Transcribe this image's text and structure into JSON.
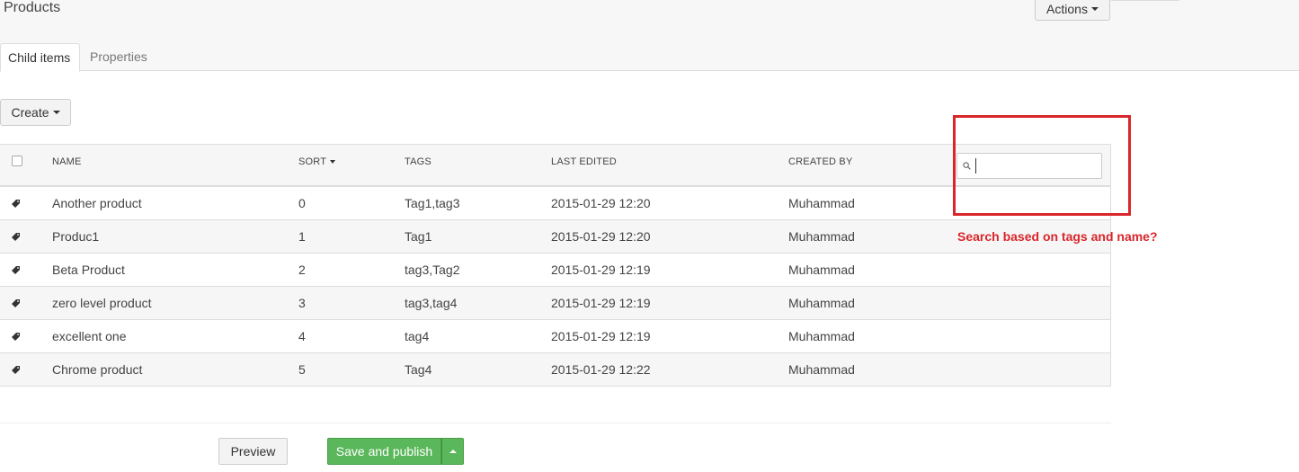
{
  "header": {
    "title": "Products",
    "actions_label": "Actions"
  },
  "tabs": [
    {
      "label": "Child items",
      "active": true
    },
    {
      "label": "Properties",
      "active": false
    }
  ],
  "toolbar": {
    "create_label": "Create"
  },
  "grid": {
    "columns": {
      "name": "NAME",
      "sort": "SORT",
      "tags": "TAGS",
      "last_edited": "LAST EDITED",
      "created_by": "CREATED BY"
    },
    "search": {
      "value": "",
      "placeholder": ""
    },
    "rows": [
      {
        "name": "Another product",
        "sort": "0",
        "tags": "Tag1,tag3",
        "last_edited": "2015-01-29 12:20",
        "created_by": "Muhammad"
      },
      {
        "name": "Produc1",
        "sort": "1",
        "tags": "Tag1",
        "last_edited": "2015-01-29 12:20",
        "created_by": "Muhammad"
      },
      {
        "name": "Beta Product",
        "sort": "2",
        "tags": "tag3,Tag2",
        "last_edited": "2015-01-29 12:19",
        "created_by": "Muhammad"
      },
      {
        "name": "zero level product",
        "sort": "3",
        "tags": "tag3,tag4",
        "last_edited": "2015-01-29 12:19",
        "created_by": "Muhammad"
      },
      {
        "name": "excellent one",
        "sort": "4",
        "tags": "tag4",
        "last_edited": "2015-01-29 12:19",
        "created_by": "Muhammad"
      },
      {
        "name": "Chrome product",
        "sort": "5",
        "tags": "Tag4",
        "last_edited": "2015-01-29 12:22",
        "created_by": "Muhammad"
      }
    ]
  },
  "annotation": {
    "text": "Search based on tags and name?",
    "color": "#d9262b"
  },
  "footer": {
    "preview_label": "Preview",
    "publish_label": "Save and publish",
    "publish_color": "#5bb75b"
  },
  "icons": {
    "row_icon": "tag-icon",
    "search_icon": "magnifier-icon"
  }
}
